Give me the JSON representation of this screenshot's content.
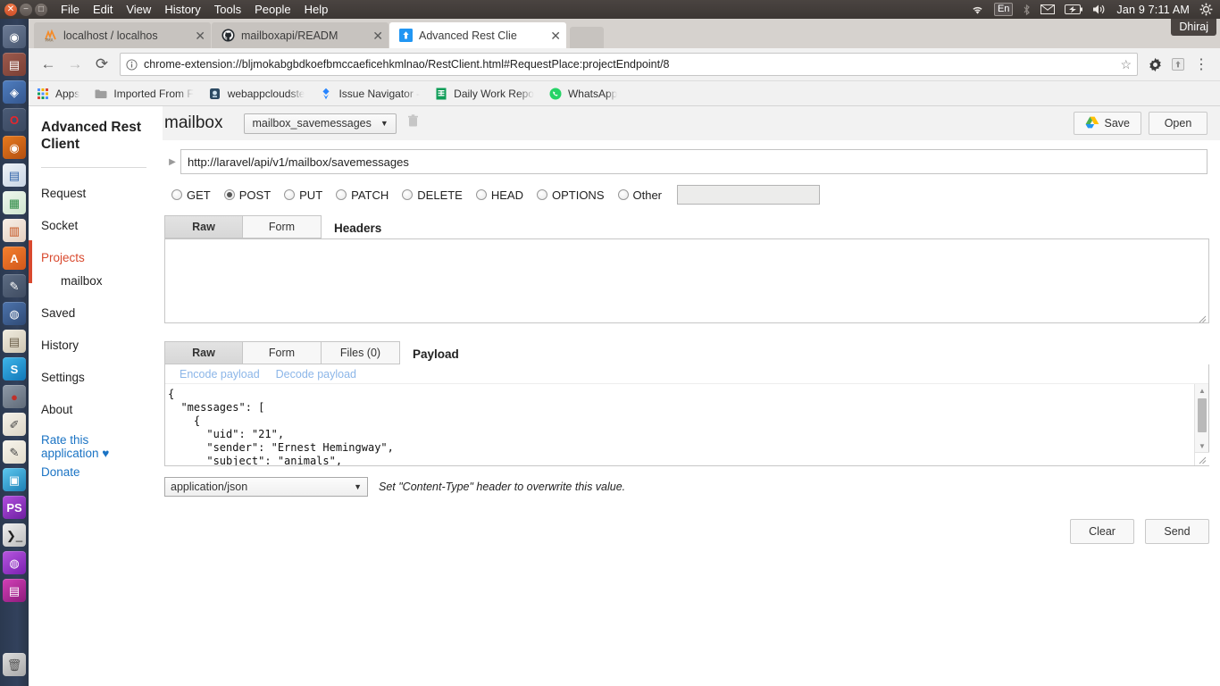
{
  "os_panel": {
    "window_controls": [
      "close",
      "minimize",
      "maximize"
    ],
    "menu": [
      "File",
      "Edit",
      "View",
      "History",
      "Tools",
      "People",
      "Help"
    ],
    "tray": {
      "wifi_icon": "wifi-icon",
      "keyboard_layout": "En",
      "bluetooth_icon": "bluetooth-icon",
      "mail_icon": "mail-icon",
      "battery_icon": "battery-icon",
      "volume_icon": "volume-icon",
      "clock": "Jan 9 7:11 AM",
      "gear_icon": "gear-icon"
    },
    "user": "Dhiraj"
  },
  "launcher": {
    "items": [
      {
        "name": "dash-home-icon",
        "glyph": "◉",
        "color": "#5b6b86"
      },
      {
        "name": "files-icon",
        "glyph": "▤",
        "color": "#8c4a3f"
      },
      {
        "name": "ubuntu-software-icon",
        "glyph": "🛍",
        "color": "#3f69a8"
      },
      {
        "name": "opera-icon",
        "glyph": "O",
        "color": "#d2232a"
      },
      {
        "name": "firefox-icon",
        "glyph": "🦊",
        "color": "#e4681a"
      },
      {
        "name": "libreoffice-writer-icon",
        "glyph": "▤",
        "color": "#3f6fa8"
      },
      {
        "name": "libreoffice-calc-icon",
        "glyph": "▦",
        "color": "#2e8b45"
      },
      {
        "name": "libreoffice-impress-icon",
        "glyph": "▥",
        "color": "#c4501c"
      },
      {
        "name": "ubuntu-amazon-icon",
        "glyph": "A",
        "color": "#e85a20"
      },
      {
        "name": "gimp-icon",
        "glyph": "✎",
        "color": "#59667d"
      },
      {
        "name": "browser-globe-icon",
        "glyph": "🌐",
        "color": "#3f69a8"
      },
      {
        "name": "calculator-icon",
        "glyph": "▤",
        "color": "#cfc9bd"
      },
      {
        "name": "skype-icon",
        "glyph": "S",
        "color": "#1d9bdb"
      },
      {
        "name": "bug-report-icon",
        "glyph": "●",
        "color": "#9a3b3b"
      },
      {
        "name": "text-editor-icon",
        "glyph": "✐",
        "color": "#e8e4dc"
      },
      {
        "name": "notes-icon",
        "glyph": "✎",
        "color": "#efeae0"
      },
      {
        "name": "vlc-icon",
        "glyph": "▣",
        "color": "#2f9fd0"
      },
      {
        "name": "phpstorm-icon",
        "glyph": "PS",
        "color": "#8f3fd0"
      },
      {
        "name": "terminal-icon",
        "glyph": "❯_",
        "color": "#d6d6d6"
      },
      {
        "name": "sublime-icon",
        "glyph": "◍",
        "color": "#a13fc8"
      },
      {
        "name": "workspace-switcher-icon",
        "glyph": "▤",
        "color": "#b5229b"
      },
      {
        "name": "trash-icon",
        "glyph": "🗑",
        "color": "#c3c3c3"
      }
    ]
  },
  "browser": {
    "tabs": [
      {
        "title": "localhost / localhos",
        "favicon": "phpmyadmin-icon",
        "active": false
      },
      {
        "title": "mailboxapi/READM",
        "favicon": "github-icon",
        "active": false
      },
      {
        "title": "Advanced Rest Clie",
        "favicon": "arc-icon",
        "active": true
      }
    ],
    "close_glyph": "✕",
    "nav": {
      "back_icon": "back-arrow-icon",
      "forward_icon": "forward-arrow-icon",
      "reload_icon": "reload-icon"
    },
    "omnibox": {
      "info_icon": "page-info-icon",
      "url": "chrome-extension://bljmokabgbdkoefbmccaeficehkmlnao/RestClient.html#RequestPlace:projectEndpoint/8",
      "star_icon": "bookmark-star-icon"
    },
    "toolbar_icons": [
      "extension-gear-icon",
      "extension-upload-icon",
      "chrome-menu-icon"
    ],
    "bookmarks": [
      {
        "label": "Apps",
        "icon": "apps-grid-icon"
      },
      {
        "label": "Imported From F",
        "icon": "folder-icon"
      },
      {
        "label": "webappcloudste",
        "icon": "webapp-icon"
      },
      {
        "label": "Issue Navigator -",
        "icon": "jira-icon"
      },
      {
        "label": "Daily Work Repo",
        "icon": "sheets-icon"
      },
      {
        "label": "WhatsApp",
        "icon": "whatsapp-icon"
      }
    ]
  },
  "app": {
    "title": "Advanced Rest Client",
    "sidebar": [
      {
        "label": "Request",
        "state": "normal"
      },
      {
        "label": "Socket",
        "state": "normal"
      },
      {
        "label": "Projects",
        "state": "active"
      },
      {
        "label": "mailbox",
        "state": "sub"
      },
      {
        "label": "Saved",
        "state": "normal"
      },
      {
        "label": "History",
        "state": "normal"
      },
      {
        "label": "Settings",
        "state": "normal"
      },
      {
        "label": "About",
        "state": "normal"
      },
      {
        "label": "Rate this application ♥",
        "state": "link"
      },
      {
        "label": "Donate",
        "state": "link"
      }
    ],
    "header": {
      "project_name": "mailbox",
      "endpoint_selected": "mailbox_savemessages",
      "endpoint_caret": "▼",
      "delete_icon": "trash-icon",
      "save_label": "Save",
      "save_icon": "google-drive-icon",
      "open_label": "Open"
    },
    "url_row": {
      "expander_icon": "expand-triangle-icon",
      "url": "http://laravel/api/v1/mailbox/savemessages"
    },
    "methods": [
      {
        "label": "GET",
        "selected": false
      },
      {
        "label": "POST",
        "selected": true
      },
      {
        "label": "PUT",
        "selected": false
      },
      {
        "label": "PATCH",
        "selected": false
      },
      {
        "label": "DELETE",
        "selected": false
      },
      {
        "label": "HEAD",
        "selected": false
      },
      {
        "label": "OPTIONS",
        "selected": false
      },
      {
        "label": "Other",
        "selected": false
      }
    ],
    "other_method_value": "",
    "headers_section": {
      "tabs": [
        {
          "label": "Raw",
          "active": true
        },
        {
          "label": "Form",
          "active": false
        }
      ],
      "title": "Headers",
      "value": ""
    },
    "payload_section": {
      "tabs": [
        {
          "label": "Raw",
          "active": true
        },
        {
          "label": "Form",
          "active": false
        },
        {
          "label": "Files (0)",
          "active": false
        }
      ],
      "title": "Payload",
      "encode_label": "Encode payload",
      "decode_label": "Decode payload",
      "body": "{\n  \"messages\": [\n    {\n      \"uid\": \"21\",\n      \"sender\": \"Ernest Hemingway\",\n      \"subject\": \"animals\",\n      \"message\": \"This is a tale about nihilism. The story is about a combative nuclear engineer who hates animals. It starts in a ghost town on a"
    },
    "content_type": {
      "value": "application/json",
      "caret": "▼",
      "note": "Set \"Content-Type\" header to overwrite this value."
    },
    "actions": {
      "clear_label": "Clear",
      "send_label": "Send"
    }
  },
  "colors": {
    "accent_red": "#d9492e",
    "link_blue": "#1a73c4",
    "panel_bg": "#3c3734",
    "launcher_bg": "#32415c"
  }
}
